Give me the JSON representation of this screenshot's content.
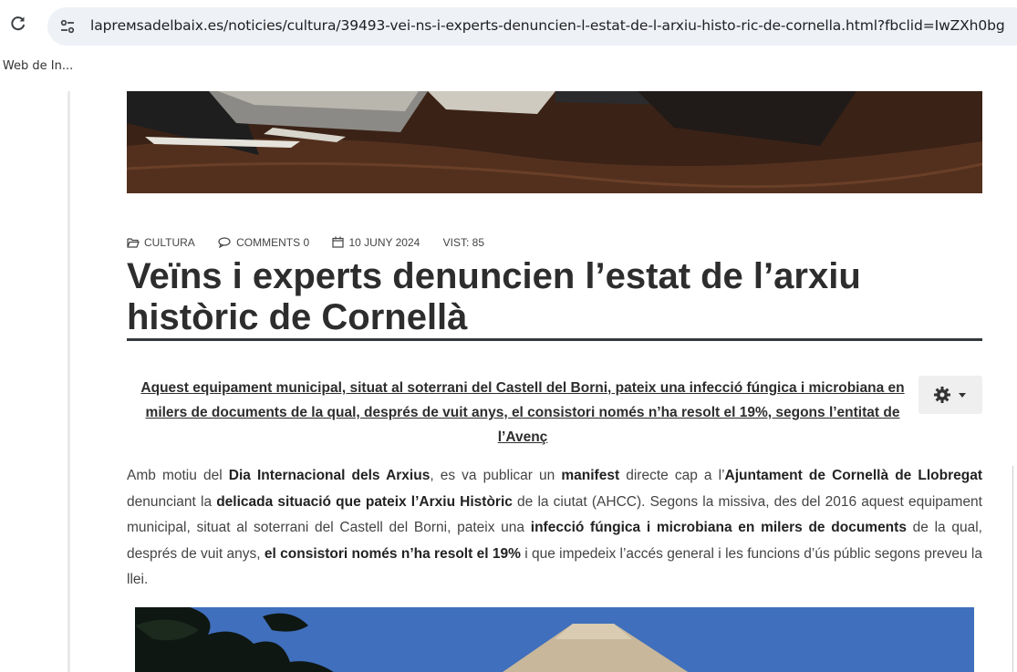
{
  "browser": {
    "url": "laprемsadelbaix.es/noticies/cultura/39493-vei-ns-i-experts-denuncien-l-estat-de-l-arxiu-histo-ric-de-cornella.html?fbclid=IwZXh0bg",
    "bookmark": "s Web de In..."
  },
  "article": {
    "meta": {
      "category": "CULTURA",
      "comments": "COMMENTS 0",
      "date": "10 JUNY 2024",
      "views": "VIST: 85"
    },
    "title": "Veïns i experts denuncien l’estat de l’arxiu històric de Cornellà",
    "lead": "Aquest equipament municipal, situat al soterrani del Castell del Borni, pateix una infecció fúngica i microbiana en milers de documents de la qual, després de vuit anys, el consistori només n’ha resolt el 19%, segons l’entitat de l’Avenç",
    "body": {
      "t1": "Amb motiu del ",
      "b1": "Dia Internacional dels Arxius",
      "t2": ", es va publicar un ",
      "b2": "manifest",
      "t3": " directe cap a l’",
      "b3": "Ajuntament de Cornellà de Llobregat",
      "t4": " denunciant la ",
      "b4": "delicada situació que pateix l’Arxiu Històric",
      "t5": " de la ciutat (AHCC). Segons la missiva, des del 2016 aquest equipament municipal, situat al soterrani del Castell del Borni, pateix una ",
      "b5": "infecció fúngica i microbiana en milers de documents",
      "t6": " de la qual, després de vuit anys, ",
      "b6": "el consistori només n’ha resolt el 19%",
      "t7": " i que impedeix l’accés general i les funcions d’ús públic segons preveu la llei."
    }
  },
  "icons": {
    "reload": "reload-icon",
    "site_info": "tune-icon",
    "category": "folder-open-icon",
    "comments": "comments-icon",
    "date": "calendar-icon",
    "tools": "gear-icon"
  },
  "colors": {
    "title": "#2d2d2d",
    "rule": "#35393b",
    "url_bar": "#eef1f6"
  }
}
